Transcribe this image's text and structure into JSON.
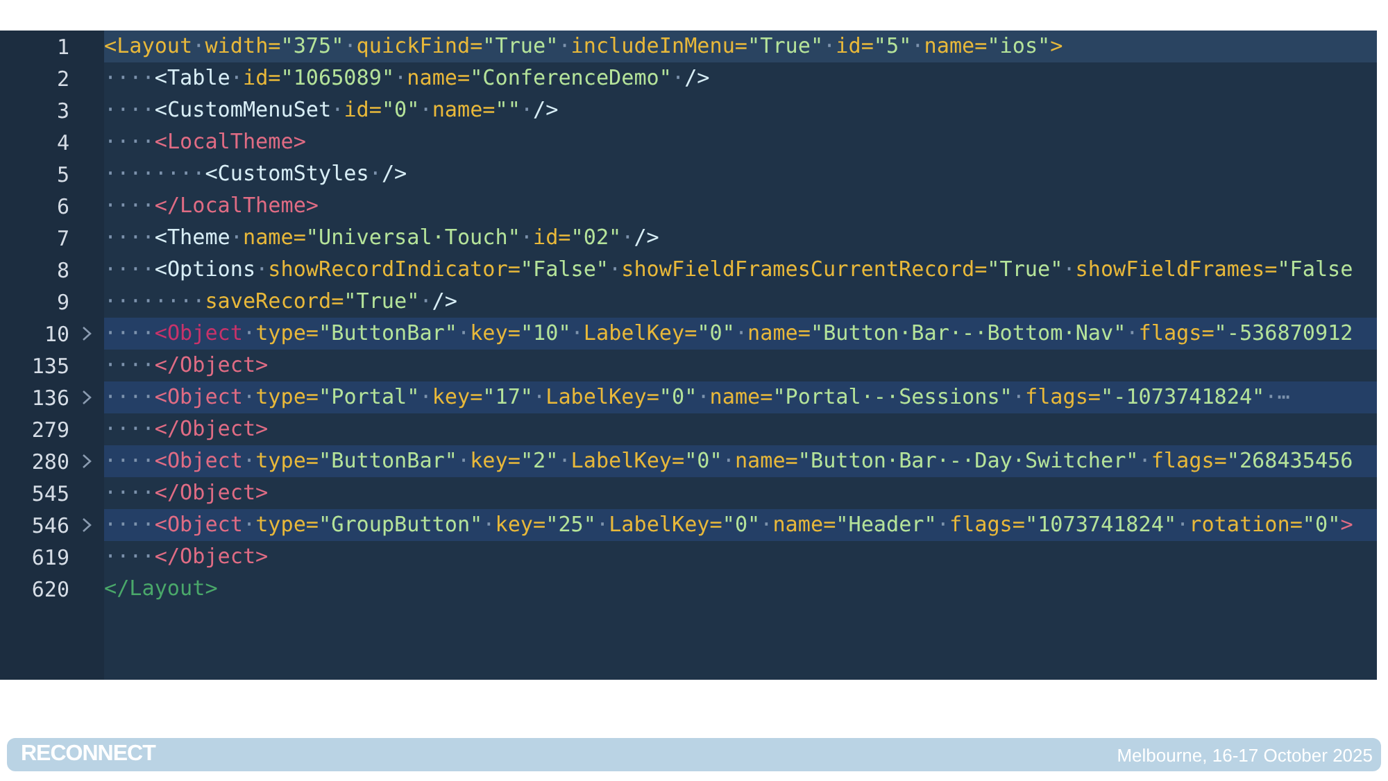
{
  "editor": {
    "lines": [
      {
        "number": "1",
        "folded": false,
        "current": true,
        "tokens": [
          {
            "kind": "ytag",
            "t": "<Layout"
          },
          {
            "kind": "ws",
            "t": "·"
          },
          {
            "kind": "attr",
            "t": "width="
          },
          {
            "kind": "str",
            "t": "\"375\""
          },
          {
            "kind": "ws",
            "t": "·"
          },
          {
            "kind": "attr",
            "t": "quickFind="
          },
          {
            "kind": "str",
            "t": "\"True\""
          },
          {
            "kind": "ws",
            "t": "·"
          },
          {
            "kind": "attr",
            "t": "includeInMenu="
          },
          {
            "kind": "str",
            "t": "\"True\""
          },
          {
            "kind": "ws",
            "t": "·"
          },
          {
            "kind": "attr",
            "t": "id="
          },
          {
            "kind": "str",
            "t": "\"5\""
          },
          {
            "kind": "ws",
            "t": "·"
          },
          {
            "kind": "attr",
            "t": "name="
          },
          {
            "kind": "str",
            "t": "\"ios\""
          },
          {
            "kind": "ytag",
            "t": ">"
          }
        ]
      },
      {
        "number": "2",
        "folded": false,
        "current": false,
        "tokens": [
          {
            "kind": "ws",
            "t": "····"
          },
          {
            "kind": "tag",
            "t": "<Table"
          },
          {
            "kind": "ws",
            "t": "·"
          },
          {
            "kind": "attr",
            "t": "id="
          },
          {
            "kind": "str",
            "t": "\"1065089\""
          },
          {
            "kind": "ws",
            "t": "·"
          },
          {
            "kind": "attr",
            "t": "name="
          },
          {
            "kind": "str",
            "t": "\"ConferenceDemo\""
          },
          {
            "kind": "ws",
            "t": "·"
          },
          {
            "kind": "tag",
            "t": "/>"
          }
        ]
      },
      {
        "number": "3",
        "folded": false,
        "current": false,
        "tokens": [
          {
            "kind": "ws",
            "t": "····"
          },
          {
            "kind": "tag",
            "t": "<CustomMenuSet"
          },
          {
            "kind": "ws",
            "t": "·"
          },
          {
            "kind": "attr",
            "t": "id="
          },
          {
            "kind": "str",
            "t": "\"0\""
          },
          {
            "kind": "ws",
            "t": "·"
          },
          {
            "kind": "attr",
            "t": "name="
          },
          {
            "kind": "str",
            "t": "\"\""
          },
          {
            "kind": "ws",
            "t": "·"
          },
          {
            "kind": "tag",
            "t": "/>"
          }
        ]
      },
      {
        "number": "4",
        "folded": false,
        "current": false,
        "tokens": [
          {
            "kind": "ws",
            "t": "····"
          },
          {
            "kind": "ptag",
            "t": "<LocalTheme>"
          }
        ]
      },
      {
        "number": "5",
        "folded": false,
        "current": false,
        "tokens": [
          {
            "kind": "ws",
            "t": "········"
          },
          {
            "kind": "tag",
            "t": "<CustomStyles"
          },
          {
            "kind": "ws",
            "t": "·"
          },
          {
            "kind": "tag",
            "t": "/>"
          }
        ]
      },
      {
        "number": "6",
        "folded": false,
        "current": false,
        "tokens": [
          {
            "kind": "ws",
            "t": "····"
          },
          {
            "kind": "ptag",
            "t": "</LocalTheme>"
          }
        ]
      },
      {
        "number": "7",
        "folded": false,
        "current": false,
        "tokens": [
          {
            "kind": "ws",
            "t": "····"
          },
          {
            "kind": "tag",
            "t": "<Theme"
          },
          {
            "kind": "ws",
            "t": "·"
          },
          {
            "kind": "attr",
            "t": "name="
          },
          {
            "kind": "str",
            "t": "\"Universal·Touch\""
          },
          {
            "kind": "ws",
            "t": "·"
          },
          {
            "kind": "attr",
            "t": "id="
          },
          {
            "kind": "str",
            "t": "\"02\""
          },
          {
            "kind": "ws",
            "t": "·"
          },
          {
            "kind": "tag",
            "t": "/>"
          }
        ]
      },
      {
        "number": "8",
        "folded": false,
        "current": false,
        "tokens": [
          {
            "kind": "ws",
            "t": "····"
          },
          {
            "kind": "tag",
            "t": "<Options"
          },
          {
            "kind": "ws",
            "t": "·"
          },
          {
            "kind": "attr",
            "t": "showRecordIndicator="
          },
          {
            "kind": "str",
            "t": "\"False\""
          },
          {
            "kind": "ws",
            "t": "·"
          },
          {
            "kind": "attr",
            "t": "showFieldFramesCurrentRecord="
          },
          {
            "kind": "str",
            "t": "\"True\""
          },
          {
            "kind": "ws",
            "t": "·"
          },
          {
            "kind": "attr",
            "t": "showFieldFrames="
          },
          {
            "kind": "str",
            "t": "\"False"
          }
        ]
      },
      {
        "number": "9",
        "folded": false,
        "current": false,
        "tokens": [
          {
            "kind": "ws",
            "t": "········"
          },
          {
            "kind": "attr",
            "t": "saveRecord="
          },
          {
            "kind": "str",
            "t": "\"True\""
          },
          {
            "kind": "ws",
            "t": "·"
          },
          {
            "kind": "tag",
            "t": "/>"
          }
        ]
      },
      {
        "number": "10",
        "folded": true,
        "current": false,
        "tokens": [
          {
            "kind": "ws",
            "t": "····"
          },
          {
            "kind": "mtag",
            "t": "<Object"
          },
          {
            "kind": "ws",
            "t": "·"
          },
          {
            "kind": "attr",
            "t": "type="
          },
          {
            "kind": "str",
            "t": "\"ButtonBar\""
          },
          {
            "kind": "ws",
            "t": "·"
          },
          {
            "kind": "attr",
            "t": "key="
          },
          {
            "kind": "str",
            "t": "\"10\""
          },
          {
            "kind": "ws",
            "t": "·"
          },
          {
            "kind": "attr",
            "t": "LabelKey="
          },
          {
            "kind": "str",
            "t": "\"0\""
          },
          {
            "kind": "ws",
            "t": "·"
          },
          {
            "kind": "attr",
            "t": "name="
          },
          {
            "kind": "str",
            "t": "\"Button·Bar·-·Bottom·Nav\""
          },
          {
            "kind": "ws",
            "t": "·"
          },
          {
            "kind": "attr",
            "t": "flags="
          },
          {
            "kind": "str",
            "t": "\"-536870912"
          }
        ]
      },
      {
        "number": "135",
        "folded": false,
        "current": false,
        "tokens": [
          {
            "kind": "ws",
            "t": "····"
          },
          {
            "kind": "ptag",
            "t": "</Object>"
          }
        ]
      },
      {
        "number": "136",
        "folded": true,
        "current": false,
        "tokens": [
          {
            "kind": "ws",
            "t": "····"
          },
          {
            "kind": "ptag",
            "t": "<Object"
          },
          {
            "kind": "ws",
            "t": "·"
          },
          {
            "kind": "attr",
            "t": "type="
          },
          {
            "kind": "str",
            "t": "\"Portal\""
          },
          {
            "kind": "ws",
            "t": "·"
          },
          {
            "kind": "attr",
            "t": "key="
          },
          {
            "kind": "str",
            "t": "\"17\""
          },
          {
            "kind": "ws",
            "t": "·"
          },
          {
            "kind": "attr",
            "t": "LabelKey="
          },
          {
            "kind": "str",
            "t": "\"0\""
          },
          {
            "kind": "ws",
            "t": "·"
          },
          {
            "kind": "attr",
            "t": "name="
          },
          {
            "kind": "str",
            "t": "\"Portal·-·Sessions\""
          },
          {
            "kind": "ws",
            "t": "·"
          },
          {
            "kind": "attr",
            "t": "flags="
          },
          {
            "kind": "str",
            "t": "\"-1073741824\""
          },
          {
            "kind": "ws",
            "t": "·⋯"
          }
        ]
      },
      {
        "number": "279",
        "folded": false,
        "current": false,
        "tokens": [
          {
            "kind": "ws",
            "t": "····"
          },
          {
            "kind": "ptag",
            "t": "</Object>"
          }
        ]
      },
      {
        "number": "280",
        "folded": true,
        "current": false,
        "tokens": [
          {
            "kind": "ws",
            "t": "····"
          },
          {
            "kind": "ptag",
            "t": "<Object"
          },
          {
            "kind": "ws",
            "t": "·"
          },
          {
            "kind": "attr",
            "t": "type="
          },
          {
            "kind": "str",
            "t": "\"ButtonBar\""
          },
          {
            "kind": "ws",
            "t": "·"
          },
          {
            "kind": "attr",
            "t": "key="
          },
          {
            "kind": "str",
            "t": "\"2\""
          },
          {
            "kind": "ws",
            "t": "·"
          },
          {
            "kind": "attr",
            "t": "LabelKey="
          },
          {
            "kind": "str",
            "t": "\"0\""
          },
          {
            "kind": "ws",
            "t": "·"
          },
          {
            "kind": "attr",
            "t": "name="
          },
          {
            "kind": "str",
            "t": "\"Button·Bar·-·Day·Switcher\""
          },
          {
            "kind": "ws",
            "t": "·"
          },
          {
            "kind": "attr",
            "t": "flags="
          },
          {
            "kind": "str",
            "t": "\"268435456"
          }
        ]
      },
      {
        "number": "545",
        "folded": false,
        "current": false,
        "tokens": [
          {
            "kind": "ws",
            "t": "····"
          },
          {
            "kind": "ptag",
            "t": "</Object>"
          }
        ]
      },
      {
        "number": "546",
        "folded": true,
        "current": false,
        "tokens": [
          {
            "kind": "ws",
            "t": "····"
          },
          {
            "kind": "ptag",
            "t": "<Object"
          },
          {
            "kind": "ws",
            "t": "·"
          },
          {
            "kind": "attr",
            "t": "type="
          },
          {
            "kind": "str",
            "t": "\"GroupButton\""
          },
          {
            "kind": "ws",
            "t": "·"
          },
          {
            "kind": "attr",
            "t": "key="
          },
          {
            "kind": "str",
            "t": "\"25\""
          },
          {
            "kind": "ws",
            "t": "·"
          },
          {
            "kind": "attr",
            "t": "LabelKey="
          },
          {
            "kind": "str",
            "t": "\"0\""
          },
          {
            "kind": "ws",
            "t": "·"
          },
          {
            "kind": "attr",
            "t": "name="
          },
          {
            "kind": "str",
            "t": "\"Header\""
          },
          {
            "kind": "ws",
            "t": "·"
          },
          {
            "kind": "attr",
            "t": "flags="
          },
          {
            "kind": "str",
            "t": "\"1073741824\""
          },
          {
            "kind": "ws",
            "t": "·"
          },
          {
            "kind": "attr",
            "t": "rotation="
          },
          {
            "kind": "str",
            "t": "\"0\""
          },
          {
            "kind": "ptag",
            "t": ">"
          }
        ]
      },
      {
        "number": "619",
        "folded": false,
        "current": false,
        "tokens": [
          {
            "kind": "ws",
            "t": "····"
          },
          {
            "kind": "ptag",
            "t": "</Object>"
          }
        ]
      },
      {
        "number": "620",
        "folded": false,
        "current": false,
        "tokens": [
          {
            "kind": "gtag",
            "t": "</Layout>"
          }
        ]
      }
    ]
  },
  "footer": {
    "brand": "RECONNECT",
    "event": "Melbourne, 16-17 October 2025"
  }
}
